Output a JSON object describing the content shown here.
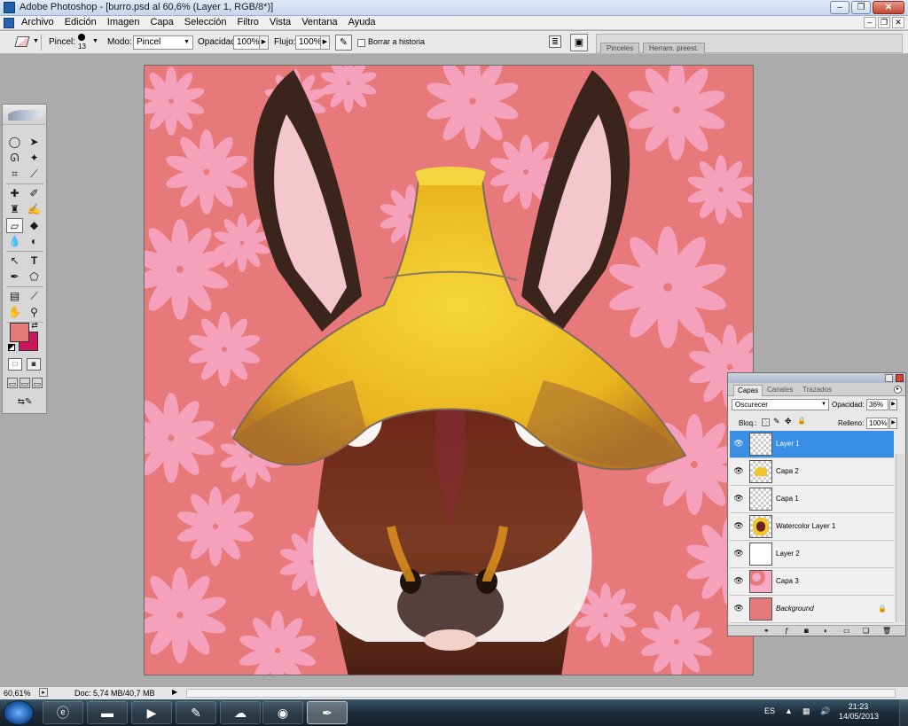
{
  "window": {
    "title": "Adobe Photoshop - [burro.psd al 60,6% (Layer 1, RGB/8*)]",
    "app_icon": "photoshop-icon"
  },
  "menubar": {
    "items": [
      "Archivo",
      "Edición",
      "Imagen",
      "Capa",
      "Selección",
      "Filtro",
      "Vista",
      "Ventana",
      "Ayuda"
    ]
  },
  "options": {
    "brush_label": "Pincel:",
    "brush_size": "13",
    "mode_label": "Modo:",
    "mode_value": "Pincel",
    "opacity_label": "Opacidad:",
    "opacity_value": "100%",
    "flow_label": "Flujo:",
    "flow_value": "100%",
    "erase_history_label": "Borrar a historia",
    "erase_history_checked": false,
    "well_tabs": [
      "Pinceles",
      "Herram. preest."
    ]
  },
  "colors": {
    "foreground": "#e57a7a",
    "background": "#c9165d",
    "canvas_bg": "#e7797b",
    "flower": "#f7a9c8",
    "hat": "#f2c62a",
    "selected_layer": "#3a8ee6"
  },
  "layers_panel": {
    "tabs": [
      "Capas",
      "Canales",
      "Trazados"
    ],
    "blend_mode": "Oscurecer",
    "opacity_label": "Opacidad:",
    "opacity_value": "36%",
    "lock_label": "Bloq.:",
    "fill_label": "Relleno:",
    "fill_value": "100%",
    "layers": [
      {
        "name": "Layer 1",
        "selected": true,
        "visible": true,
        "thumb": "transparent"
      },
      {
        "name": "Capa 2",
        "selected": false,
        "visible": true,
        "thumb": "hat"
      },
      {
        "name": "Capa 1",
        "selected": false,
        "visible": true,
        "thumb": "transparent"
      },
      {
        "name": "Watercolor Layer 1",
        "selected": false,
        "visible": true,
        "thumb": "donkey"
      },
      {
        "name": "Layer 2",
        "selected": false,
        "visible": true,
        "thumb": "transparent"
      },
      {
        "name": "Capa 3",
        "selected": false,
        "visible": true,
        "thumb": "flowers"
      },
      {
        "name": "Background",
        "selected": false,
        "visible": true,
        "thumb": "fill",
        "locked": true
      }
    ]
  },
  "status": {
    "zoom": "60,61%",
    "doc_info": "Doc: 5,74 MB/40,7 MB"
  },
  "taskbar": {
    "apps": [
      "internet-explorer-icon",
      "folder-icon",
      "media-player-icon",
      "pen-tablet-icon",
      "network-icon",
      "chrome-icon",
      "photoshop-icon"
    ],
    "language": "ES",
    "time": "21:23",
    "date": "14/05/2013"
  }
}
